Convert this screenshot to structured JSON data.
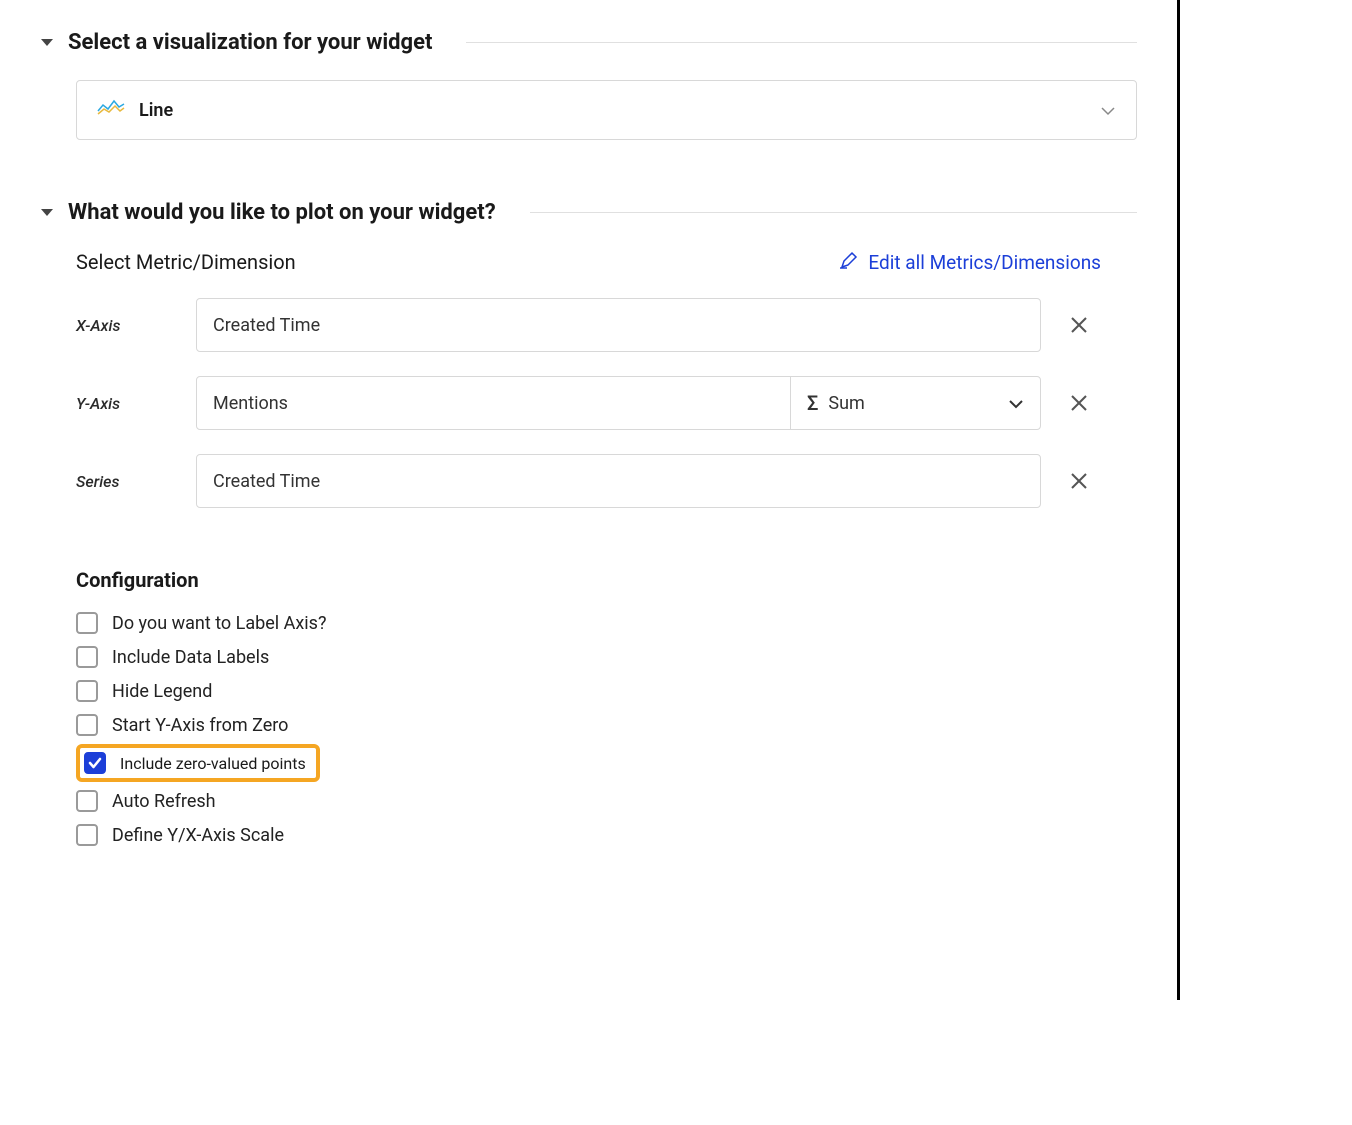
{
  "sections": {
    "visualization": {
      "title": "Select a visualization for your widget",
      "selected": "Line"
    },
    "plot": {
      "title": "What would you like to plot on your widget?",
      "metric_label": "Select Metric/Dimension",
      "edit_link": "Edit all Metrics/Dimensions",
      "axes": {
        "x": {
          "label": "X-Axis",
          "value": "Created Time"
        },
        "y": {
          "label": "Y-Axis",
          "value": "Mentions",
          "aggregation": "Sum"
        },
        "series": {
          "label": "Series",
          "value": "Created Time"
        }
      }
    },
    "configuration": {
      "title": "Configuration",
      "options": [
        {
          "label": "Do you want to Label Axis?",
          "checked": false
        },
        {
          "label": "Include Data Labels",
          "checked": false
        },
        {
          "label": "Hide Legend",
          "checked": false
        },
        {
          "label": "Start Y-Axis from Zero",
          "checked": false
        },
        {
          "label": "Include zero-valued points",
          "checked": true,
          "highlighted": true
        },
        {
          "label": "Auto Refresh",
          "checked": false
        },
        {
          "label": "Define Y/X-Axis Scale",
          "checked": false
        }
      ]
    }
  }
}
